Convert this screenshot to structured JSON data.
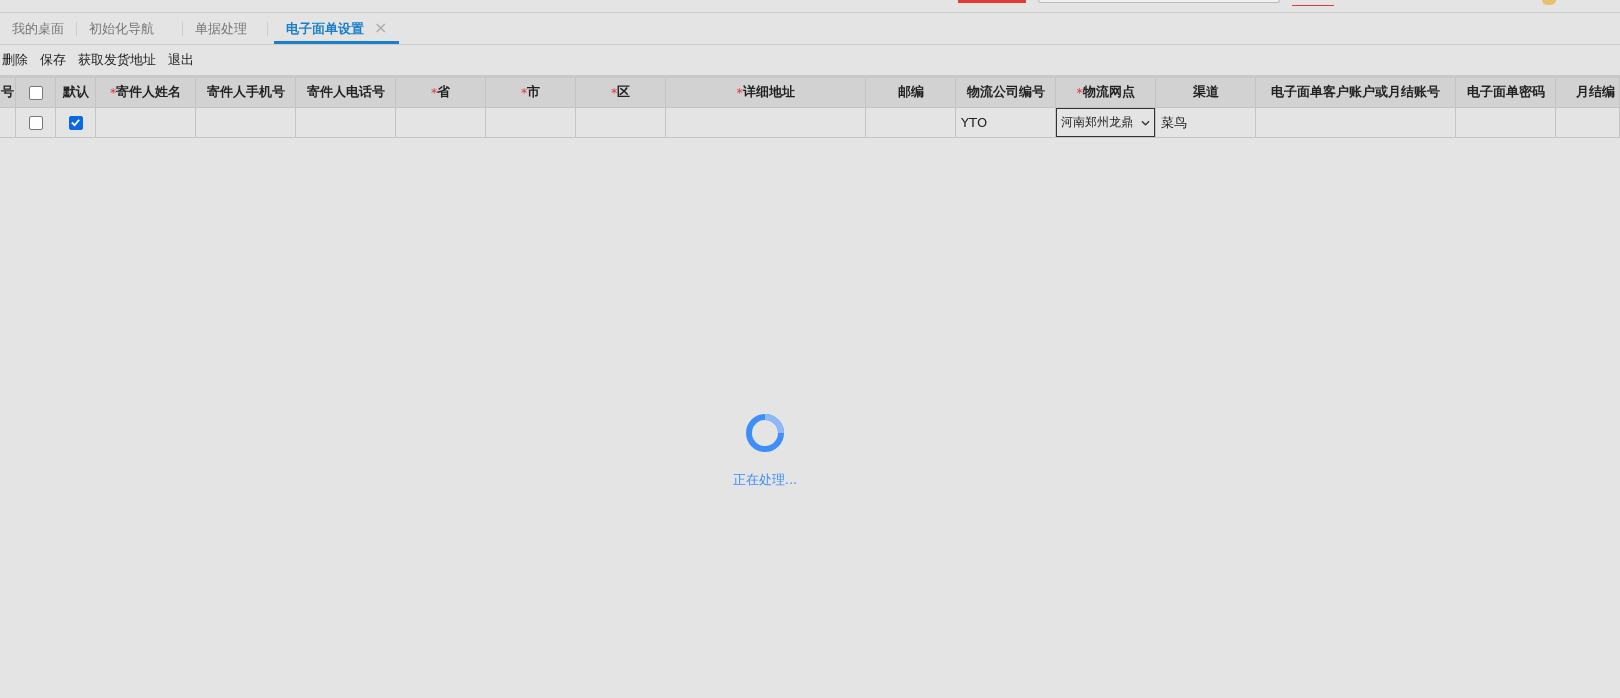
{
  "tabs": [
    {
      "label": "我的桌面",
      "selected": false,
      "closable": false
    },
    {
      "label": "初始化导航",
      "selected": false,
      "closable": false
    },
    {
      "label": "单据处理",
      "selected": false,
      "closable": false
    },
    {
      "label": "电子面单设置",
      "selected": true,
      "closable": true,
      "close_glyph": "×"
    }
  ],
  "toolbar": [
    "删除",
    "保存",
    "获取发货地址",
    "退出"
  ],
  "table": {
    "columns": [
      {
        "label": "号",
        "kind": "text"
      },
      {
        "kind": "checkbox"
      },
      {
        "label": "默认",
        "kind": "text"
      },
      {
        "label": "寄件人姓名",
        "required_mark": "*",
        "kind": "text"
      },
      {
        "label": "寄件人手机号",
        "kind": "text"
      },
      {
        "label": "寄件人电话号",
        "kind": "text"
      },
      {
        "label": "省",
        "required_mark": "*",
        "kind": "text"
      },
      {
        "label": "市",
        "required_mark": "*",
        "kind": "text"
      },
      {
        "label": "区",
        "required_mark": "*",
        "kind": "text"
      },
      {
        "label": "详细地址",
        "required_mark": "*",
        "kind": "text"
      },
      {
        "label": "邮编",
        "kind": "text"
      },
      {
        "label": "物流公司编号",
        "kind": "text"
      },
      {
        "label": "物流网点",
        "required_mark": "*",
        "kind": "text"
      },
      {
        "label": "渠道",
        "kind": "text"
      },
      {
        "label": "电子面单客户账户或月结账号",
        "kind": "text"
      },
      {
        "label": "电子面单密码",
        "kind": "text"
      },
      {
        "label": "月结编",
        "kind": "text"
      }
    ],
    "header_checkbox": {
      "checked": false
    },
    "rows": [
      {
        "cells": [
          {
            "kind": "text"
          },
          {
            "kind": "checkbox",
            "checked": false
          },
          {
            "kind": "checkbox",
            "checked": true
          },
          {
            "kind": "text"
          },
          {
            "kind": "text"
          },
          {
            "kind": "text"
          },
          {
            "kind": "text"
          },
          {
            "kind": "text"
          },
          {
            "kind": "text"
          },
          {
            "kind": "text"
          },
          {
            "kind": "text"
          },
          {
            "kind": "text",
            "value": "YTO"
          },
          {
            "kind": "select",
            "value": "河南郑州龙鼎"
          },
          {
            "kind": "text",
            "value": "菜鸟"
          },
          {
            "kind": "text"
          },
          {
            "kind": "text"
          },
          {
            "kind": "text"
          }
        ]
      }
    ]
  },
  "loading": {
    "message": "正在处理..."
  }
}
